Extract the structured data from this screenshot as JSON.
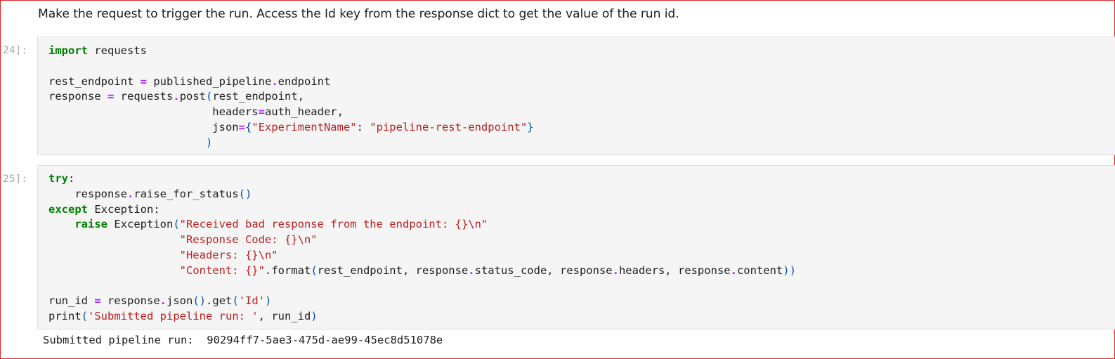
{
  "markdown": {
    "text": "Make the request to trigger the run. Access the Id key from the response dict to get the value of the run id."
  },
  "cells": [
    {
      "prompt": "24]:",
      "lines": [
        [
          {
            "t": "import",
            "c": "kw"
          },
          {
            "t": " requests"
          }
        ],
        [],
        [
          {
            "t": "rest_endpoint "
          },
          {
            "t": "=",
            "c": "op"
          },
          {
            "t": " published_pipeline"
          },
          {
            "t": ".",
            "c": "op"
          },
          {
            "t": "endpoint"
          }
        ],
        [
          {
            "t": "response "
          },
          {
            "t": "=",
            "c": "op"
          },
          {
            "t": " requests"
          },
          {
            "t": ".",
            "c": "op"
          },
          {
            "t": "post"
          },
          {
            "t": "(",
            "c": "br"
          },
          {
            "t": "rest_endpoint,"
          }
        ],
        [
          {
            "t": "                         headers"
          },
          {
            "t": "=",
            "c": "op"
          },
          {
            "t": "auth_header,"
          }
        ],
        [
          {
            "t": "                         json"
          },
          {
            "t": "=",
            "c": "op"
          },
          {
            "t": "{",
            "c": "br"
          },
          {
            "t": "\"ExperimentName\"",
            "c": "str"
          },
          {
            "t": ": "
          },
          {
            "t": "\"pipeline-rest-endpoint\"",
            "c": "str"
          },
          {
            "t": "}",
            "c": "br"
          }
        ],
        [
          {
            "t": "                        "
          },
          {
            "t": ")",
            "c": "br"
          }
        ]
      ]
    },
    {
      "prompt": "25]:",
      "lines": [
        [
          {
            "t": "try",
            "c": "kw"
          },
          {
            "t": ":"
          }
        ],
        [
          {
            "t": "    response"
          },
          {
            "t": ".",
            "c": "op"
          },
          {
            "t": "raise_for_status"
          },
          {
            "t": "()",
            "c": "br"
          }
        ],
        [
          {
            "t": "except",
            "c": "kw"
          },
          {
            "t": " Exception:"
          }
        ],
        [
          {
            "t": "    "
          },
          {
            "t": "raise",
            "c": "kw"
          },
          {
            "t": " Exception"
          },
          {
            "t": "(",
            "c": "br"
          },
          {
            "t": "\"Received bad response from the endpoint: {}\\n\"",
            "c": "str"
          }
        ],
        [
          {
            "t": "                    "
          },
          {
            "t": "\"Response Code: {}\\n\"",
            "c": "str"
          }
        ],
        [
          {
            "t": "                    "
          },
          {
            "t": "\"Headers: {}\\n\"",
            "c": "str"
          }
        ],
        [
          {
            "t": "                    "
          },
          {
            "t": "\"Content: {}\"",
            "c": "str"
          },
          {
            "t": "."
          },
          {
            "t": "format"
          },
          {
            "t": "(",
            "c": "br"
          },
          {
            "t": "rest_endpoint, response"
          },
          {
            "t": ".",
            "c": "op"
          },
          {
            "t": "status_code, response"
          },
          {
            "t": ".",
            "c": "op"
          },
          {
            "t": "headers, response"
          },
          {
            "t": ".",
            "c": "op"
          },
          {
            "t": "content"
          },
          {
            "t": "))",
            "c": "br"
          }
        ],
        [],
        [
          {
            "t": "run_id "
          },
          {
            "t": "=",
            "c": "op"
          },
          {
            "t": " response"
          },
          {
            "t": ".",
            "c": "op"
          },
          {
            "t": "json"
          },
          {
            "t": "()",
            "c": "br"
          },
          {
            "t": "."
          },
          {
            "t": "get"
          },
          {
            "t": "(",
            "c": "br"
          },
          {
            "t": "'Id'",
            "c": "str"
          },
          {
            "t": ")",
            "c": "br"
          }
        ],
        [
          {
            "t": "print"
          },
          {
            "t": "(",
            "c": "br"
          },
          {
            "t": "'Submitted pipeline run: '",
            "c": "str"
          },
          {
            "t": ", run_id"
          },
          {
            "t": ")",
            "c": "br"
          }
        ]
      ]
    }
  ],
  "output": {
    "text": "Submitted pipeline run:  90294ff7-5ae3-475d-ae99-45ec8d51078e"
  }
}
